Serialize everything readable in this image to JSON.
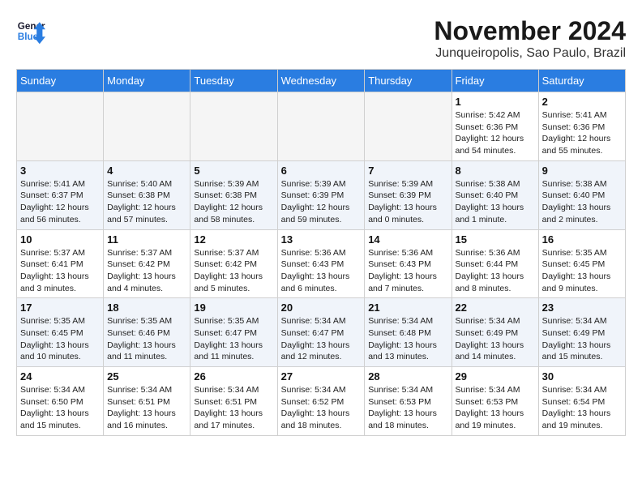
{
  "logo": {
    "line1": "General",
    "line2": "Blue"
  },
  "title": "November 2024",
  "location": "Junqueiropolis, Sao Paulo, Brazil",
  "days_of_week": [
    "Sunday",
    "Monday",
    "Tuesday",
    "Wednesday",
    "Thursday",
    "Friday",
    "Saturday"
  ],
  "weeks": [
    [
      {
        "day": "",
        "info": ""
      },
      {
        "day": "",
        "info": ""
      },
      {
        "day": "",
        "info": ""
      },
      {
        "day": "",
        "info": ""
      },
      {
        "day": "",
        "info": ""
      },
      {
        "day": "1",
        "info": "Sunrise: 5:42 AM\nSunset: 6:36 PM\nDaylight: 12 hours\nand 54 minutes."
      },
      {
        "day": "2",
        "info": "Sunrise: 5:41 AM\nSunset: 6:36 PM\nDaylight: 12 hours\nand 55 minutes."
      }
    ],
    [
      {
        "day": "3",
        "info": "Sunrise: 5:41 AM\nSunset: 6:37 PM\nDaylight: 12 hours\nand 56 minutes."
      },
      {
        "day": "4",
        "info": "Sunrise: 5:40 AM\nSunset: 6:38 PM\nDaylight: 12 hours\nand 57 minutes."
      },
      {
        "day": "5",
        "info": "Sunrise: 5:39 AM\nSunset: 6:38 PM\nDaylight: 12 hours\nand 58 minutes."
      },
      {
        "day": "6",
        "info": "Sunrise: 5:39 AM\nSunset: 6:39 PM\nDaylight: 12 hours\nand 59 minutes."
      },
      {
        "day": "7",
        "info": "Sunrise: 5:39 AM\nSunset: 6:39 PM\nDaylight: 13 hours\nand 0 minutes."
      },
      {
        "day": "8",
        "info": "Sunrise: 5:38 AM\nSunset: 6:40 PM\nDaylight: 13 hours\nand 1 minute."
      },
      {
        "day": "9",
        "info": "Sunrise: 5:38 AM\nSunset: 6:40 PM\nDaylight: 13 hours\nand 2 minutes."
      }
    ],
    [
      {
        "day": "10",
        "info": "Sunrise: 5:37 AM\nSunset: 6:41 PM\nDaylight: 13 hours\nand 3 minutes."
      },
      {
        "day": "11",
        "info": "Sunrise: 5:37 AM\nSunset: 6:42 PM\nDaylight: 13 hours\nand 4 minutes."
      },
      {
        "day": "12",
        "info": "Sunrise: 5:37 AM\nSunset: 6:42 PM\nDaylight: 13 hours\nand 5 minutes."
      },
      {
        "day": "13",
        "info": "Sunrise: 5:36 AM\nSunset: 6:43 PM\nDaylight: 13 hours\nand 6 minutes."
      },
      {
        "day": "14",
        "info": "Sunrise: 5:36 AM\nSunset: 6:43 PM\nDaylight: 13 hours\nand 7 minutes."
      },
      {
        "day": "15",
        "info": "Sunrise: 5:36 AM\nSunset: 6:44 PM\nDaylight: 13 hours\nand 8 minutes."
      },
      {
        "day": "16",
        "info": "Sunrise: 5:35 AM\nSunset: 6:45 PM\nDaylight: 13 hours\nand 9 minutes."
      }
    ],
    [
      {
        "day": "17",
        "info": "Sunrise: 5:35 AM\nSunset: 6:45 PM\nDaylight: 13 hours\nand 10 minutes."
      },
      {
        "day": "18",
        "info": "Sunrise: 5:35 AM\nSunset: 6:46 PM\nDaylight: 13 hours\nand 11 minutes."
      },
      {
        "day": "19",
        "info": "Sunrise: 5:35 AM\nSunset: 6:47 PM\nDaylight: 13 hours\nand 11 minutes."
      },
      {
        "day": "20",
        "info": "Sunrise: 5:34 AM\nSunset: 6:47 PM\nDaylight: 13 hours\nand 12 minutes."
      },
      {
        "day": "21",
        "info": "Sunrise: 5:34 AM\nSunset: 6:48 PM\nDaylight: 13 hours\nand 13 minutes."
      },
      {
        "day": "22",
        "info": "Sunrise: 5:34 AM\nSunset: 6:49 PM\nDaylight: 13 hours\nand 14 minutes."
      },
      {
        "day": "23",
        "info": "Sunrise: 5:34 AM\nSunset: 6:49 PM\nDaylight: 13 hours\nand 15 minutes."
      }
    ],
    [
      {
        "day": "24",
        "info": "Sunrise: 5:34 AM\nSunset: 6:50 PM\nDaylight: 13 hours\nand 15 minutes."
      },
      {
        "day": "25",
        "info": "Sunrise: 5:34 AM\nSunset: 6:51 PM\nDaylight: 13 hours\nand 16 minutes."
      },
      {
        "day": "26",
        "info": "Sunrise: 5:34 AM\nSunset: 6:51 PM\nDaylight: 13 hours\nand 17 minutes."
      },
      {
        "day": "27",
        "info": "Sunrise: 5:34 AM\nSunset: 6:52 PM\nDaylight: 13 hours\nand 18 minutes."
      },
      {
        "day": "28",
        "info": "Sunrise: 5:34 AM\nSunset: 6:53 PM\nDaylight: 13 hours\nand 18 minutes."
      },
      {
        "day": "29",
        "info": "Sunrise: 5:34 AM\nSunset: 6:53 PM\nDaylight: 13 hours\nand 19 minutes."
      },
      {
        "day": "30",
        "info": "Sunrise: 5:34 AM\nSunset: 6:54 PM\nDaylight: 13 hours\nand 19 minutes."
      }
    ]
  ]
}
